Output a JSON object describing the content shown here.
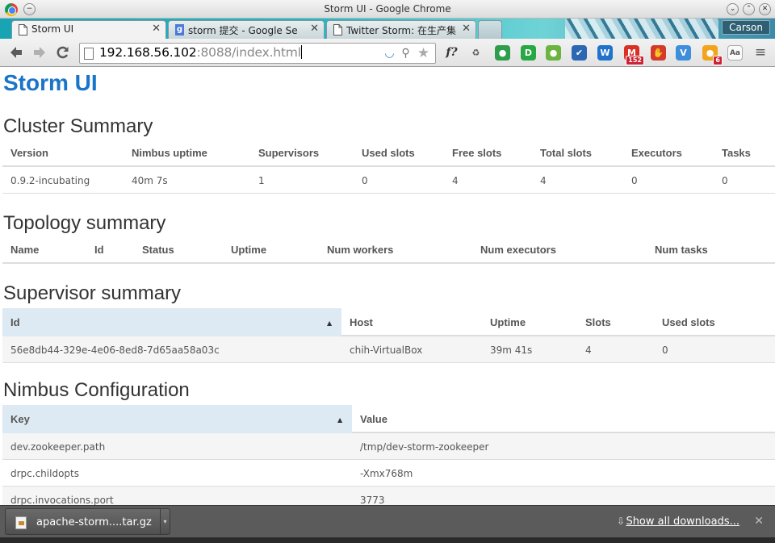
{
  "window": {
    "title": "Storm UI - Google Chrome",
    "profile": "Carson"
  },
  "tabs": [
    {
      "label": "Storm UI",
      "active": true
    },
    {
      "label": "storm 提交 - Google Se",
      "active": false
    },
    {
      "label": "Twitter Storm: 在生产集",
      "active": false
    }
  ],
  "omnibox": {
    "host": "192.168.56.102",
    "rest": ":8088/index.html"
  },
  "extensions": [
    {
      "name": "f-question-icon",
      "glyph": "f?",
      "color": "#333333"
    },
    {
      "name": "recycle-icon",
      "glyph": "♻",
      "color": "#555555"
    },
    {
      "name": "green-circle-icon",
      "glyph": "●",
      "color": "#2e9e4c"
    },
    {
      "name": "d-icon",
      "glyph": "D",
      "color": "#28a745"
    },
    {
      "name": "evernote-icon",
      "glyph": "●",
      "color": "#6cb33f"
    },
    {
      "name": "checkmark-icon",
      "glyph": "✔",
      "color": "#2b67b3"
    },
    {
      "name": "w-icon",
      "glyph": "W",
      "color": "#1f73c9"
    },
    {
      "name": "gmail-icon",
      "glyph": "M",
      "color": "#d93025",
      "badge": "152"
    },
    {
      "name": "stop-hand-icon",
      "glyph": "✋",
      "color": "#d33a2c"
    },
    {
      "name": "v-icon",
      "glyph": "V",
      "color": "#3d8fd9"
    },
    {
      "name": "fruit-icon",
      "glyph": "●",
      "color": "#f2a51a",
      "badge": "6"
    },
    {
      "name": "aa-icon",
      "glyph": "Aa",
      "color": "#555555"
    }
  ],
  "page": {
    "brand": "Storm UI",
    "cluster": {
      "heading": "Cluster Summary",
      "headers": [
        "Version",
        "Nimbus uptime",
        "Supervisors",
        "Used slots",
        "Free slots",
        "Total slots",
        "Executors",
        "Tasks"
      ],
      "rows": [
        [
          "0.9.2-incubating",
          "40m 7s",
          "1",
          "0",
          "4",
          "4",
          "0",
          "0"
        ]
      ]
    },
    "topology": {
      "heading": "Topology summary",
      "headers": [
        "Name",
        "Id",
        "Status",
        "Uptime",
        "Num workers",
        "Num executors",
        "Num tasks"
      ]
    },
    "supervisor": {
      "heading": "Supervisor summary",
      "headers": [
        "Id",
        "Host",
        "Uptime",
        "Slots",
        "Used slots"
      ],
      "rows": [
        [
          "56e8db44-329e-4e06-8ed8-7d65aa58a03c",
          "chih-VirtualBox",
          "39m 41s",
          "4",
          "0"
        ]
      ]
    },
    "nimbus": {
      "heading": "Nimbus Configuration",
      "headers": [
        "Key",
        "Value"
      ],
      "rows": [
        [
          "dev.zookeeper.path",
          "/tmp/dev-storm-zookeeper"
        ],
        [
          "drpc.childopts",
          "-Xmx768m"
        ],
        [
          "drpc.invocations.port",
          "3773"
        ]
      ]
    }
  },
  "downloads": {
    "item_label": "apache-storm....tar.gz",
    "show_all": "Show all downloads..."
  }
}
